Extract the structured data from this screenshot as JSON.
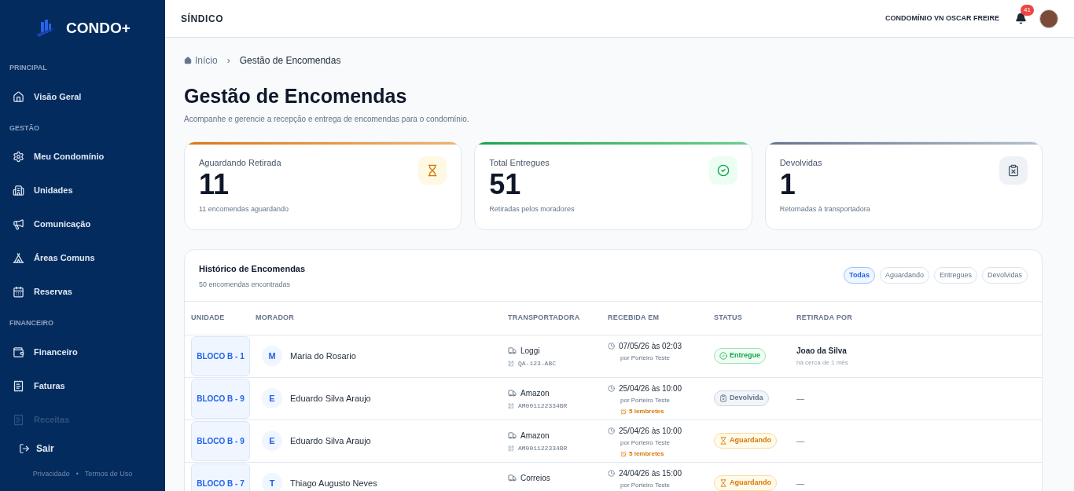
{
  "brand": "CONDO+",
  "sidebar": {
    "sections": [
      {
        "title": "PRINCIPAL",
        "items": [
          {
            "label": "Visão Geral",
            "faded": false
          }
        ]
      },
      {
        "title": "GESTÃO",
        "items": [
          {
            "label": "Meu Condomínio",
            "faded": false
          },
          {
            "label": "Unidades",
            "faded": false
          },
          {
            "label": "Comunicação",
            "faded": false
          },
          {
            "label": "Áreas Comuns",
            "faded": false
          },
          {
            "label": "Reservas",
            "faded": false
          }
        ]
      },
      {
        "title": "FINANCEIRO",
        "items": [
          {
            "label": "Financeiro",
            "faded": false
          },
          {
            "label": "Faturas",
            "faded": false
          },
          {
            "label": "Receitas",
            "faded": true
          }
        ]
      }
    ],
    "logout": "Sair",
    "footer_links": [
      "Privacidade",
      "Termos de Uso"
    ],
    "footer_separator": "•"
  },
  "header": {
    "role": "SÍNDICO",
    "condo": "CONDOMÍNIO VN OSCAR FREIRE",
    "notifications": "41"
  },
  "breadcrumb": {
    "home": "Início",
    "separator": "›",
    "current": "Gestão de Encomendas"
  },
  "page": {
    "title": "Gestão de Encomendas",
    "subtitle": "Acompanhe e gerencie a recepção e entrega de encomendas para o condomínio."
  },
  "stats": [
    {
      "kind": "waiting",
      "label": "Aguardando Retirada",
      "value": "11",
      "caption": "11 encomendas aguardando"
    },
    {
      "kind": "delivered",
      "label": "Total Entregues",
      "value": "51",
      "caption": "Retiradas pelos moradores"
    },
    {
      "kind": "returned",
      "label": "Devolvidas",
      "value": "1",
      "caption": "Retornadas à transportadora"
    }
  ],
  "history": {
    "title": "Histórico de Encomendas",
    "count": "50 encomendas encontradas",
    "filters": [
      {
        "label": "Todas",
        "selected": true
      },
      {
        "label": "Aguardando",
        "selected": false
      },
      {
        "label": "Entregues",
        "selected": false
      },
      {
        "label": "Devolvidas",
        "selected": false
      }
    ],
    "columns": [
      "UNIDADE",
      "MORADOR",
      "TRANSPORTADORA",
      "RECEBIDA EM",
      "STATUS",
      "RETIRADA POR"
    ],
    "rows": [
      {
        "unit": "BLOCO B - 1",
        "initial": "M",
        "resident": "Maria do Rosario",
        "carrier": "Loggi",
        "tracking": "QA-123-ABC",
        "received": "07/05/26 às 02:03",
        "by": "por Porteiro Teste",
        "status": {
          "kind": "delivered",
          "label": "Entregue"
        },
        "picked_by": "Joao da Silva",
        "picked_when": "há cerca de 1 mês"
      },
      {
        "unit": "BLOCO B - 9",
        "initial": "E",
        "resident": "Eduardo Silva Araujo",
        "carrier": "Amazon",
        "tracking": "AM001122334BR",
        "received": "25/04/26 às 10:00",
        "by": "por Porteiro Teste",
        "reminders": "5 lembretes",
        "status": {
          "kind": "returned",
          "label": "Devolvida"
        },
        "picked_by": "—"
      },
      {
        "unit": "BLOCO B - 9",
        "initial": "E",
        "resident": "Eduardo Silva Araujo",
        "carrier": "Amazon",
        "tracking": "AM001122334BR",
        "received": "25/04/26 às 10:00",
        "by": "por Porteiro Teste",
        "reminders": "5 lembretes",
        "status": {
          "kind": "waiting",
          "label": "Aguardando"
        },
        "picked_by": "—"
      },
      {
        "unit": "BLOCO B - 7",
        "initial": "T",
        "resident": "Thiago Augusto Neves",
        "carrier": "Correios",
        "received": "24/04/26 às 15:00",
        "by": "por Porteiro Teste",
        "status": {
          "kind": "waiting",
          "label": "Aguardando"
        },
        "picked_by": "—"
      }
    ]
  }
}
